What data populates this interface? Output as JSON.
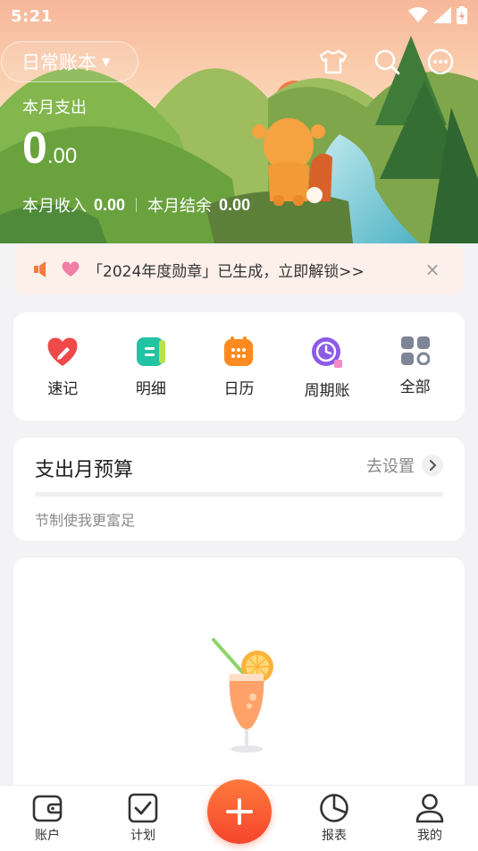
{
  "status_bar": {
    "time": "5:21"
  },
  "header": {
    "book_name": "日常账本",
    "month_expense_label": "本月支出",
    "month_expense_integer": "0",
    "month_expense_decimal": ".00",
    "month_income_label": "本月收入",
    "month_income_value": "0.00",
    "month_balance_label": "本月结余",
    "month_balance_value": "0.00",
    "icons": [
      "shirt-icon",
      "search-icon",
      "more-icon"
    ]
  },
  "notice": {
    "text": "「2024年度勋章」已生成，立即解锁>>",
    "close": "×"
  },
  "shortcuts": [
    {
      "label": "速记",
      "icon": "quick-note-icon",
      "color": "#ef4a4a"
    },
    {
      "label": "明细",
      "icon": "detail-icon",
      "color": "#22c3a3"
    },
    {
      "label": "日历",
      "icon": "calendar-icon",
      "color": "#ff8a1f"
    },
    {
      "label": "周期账",
      "icon": "cycle-bill-icon",
      "color": "#8c5ae6"
    },
    {
      "label": "全部",
      "icon": "all-grid-icon",
      "color": "#7d8596"
    }
  ],
  "budget": {
    "title": "支出月预算",
    "setting_label": "去设置",
    "progress": 0,
    "subtitle": "节制使我更富足"
  },
  "bottom_nav": [
    {
      "label": "账户",
      "icon": "wallet-icon"
    },
    {
      "label": "计划",
      "icon": "plan-check-icon"
    },
    {
      "label": "报表",
      "icon": "report-pie-icon"
    },
    {
      "label": "我的",
      "icon": "profile-icon"
    }
  ],
  "colors": {
    "accent": "#ff6a33",
    "hero_green": "#7fb84e",
    "notice_bg": "#fdf0ea"
  }
}
